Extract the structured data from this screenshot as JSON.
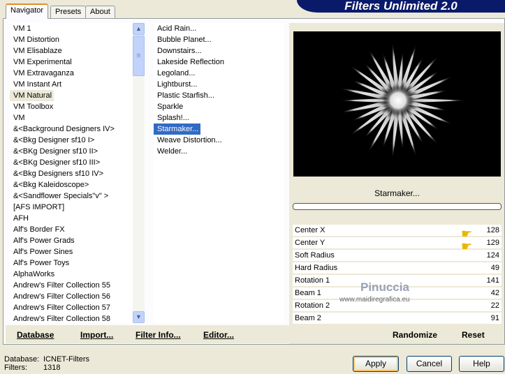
{
  "header": {
    "title": "Filters Unlimited 2.0"
  },
  "tabs": [
    "Navigator",
    "Presets",
    "About"
  ],
  "categories": [
    "VM 1",
    "VM Distortion",
    "VM Elisablaze",
    "VM Experimental",
    "VM Extravaganza",
    "VM Instant Art",
    "VM Natural",
    "VM Toolbox",
    "VM",
    "&<Background Designers IV>",
    "&<Bkg Designer sf10 I>",
    "&<BKg Designer sf10 II>",
    "&<BKg Designer sf10 III>",
    "&<Bkg Designers sf10 IV>",
    "&<Bkg Kaleidoscope>",
    "&<Sandflower Specials\"v\" >",
    "[AFS IMPORT]",
    "AFH",
    "Alf's Border FX",
    "Alf's Power Grads",
    "Alf's Power Sines",
    "Alf's Power Toys",
    "AlphaWorks",
    "Andrew's Filter Collection 55",
    "Andrew's Filter Collection 56",
    "Andrew's Filter Collection 57",
    "Andrew's Filter Collection 58"
  ],
  "selected_category": "VM Natural",
  "filters": [
    "Acid Rain...",
    "Bubble Planet...",
    "Downstairs...",
    "Lakeside Reflection",
    "Legoland...",
    "Lightburst...",
    "Plastic Starfish...",
    "Sparkle",
    "Splash!...",
    "Starmaker...",
    "Weave Distortion...",
    "Welder..."
  ],
  "selected_filter": "Starmaker...",
  "bottom_links": {
    "database": "Database",
    "import": "Import...",
    "filter_info": "Filter Info...",
    "editor": "Editor..."
  },
  "preview_label": "Starmaker...",
  "params": [
    {
      "name": "Center X",
      "value": "128"
    },
    {
      "name": "Center Y",
      "value": "129"
    },
    {
      "name": "Soft Radius",
      "value": "124"
    },
    {
      "name": "Hard Radius",
      "value": "49"
    },
    {
      "name": "Rotation 1",
      "value": "141"
    },
    {
      "name": "Beam 1",
      "value": "42"
    },
    {
      "name": "Rotation 2",
      "value": "22"
    },
    {
      "name": "Beam 2",
      "value": "91"
    }
  ],
  "randomize": "Randomize",
  "reset": "Reset",
  "watermark": {
    "name": "Pinuccia",
    "url": "www.maidiregrafica.eu"
  },
  "status": {
    "db_label": "Database:",
    "db_value": "ICNET-Filters",
    "filters_label": "Filters:",
    "filters_value": "1318"
  },
  "buttons": {
    "apply": "Apply",
    "cancel": "Cancel",
    "help": "Help"
  }
}
